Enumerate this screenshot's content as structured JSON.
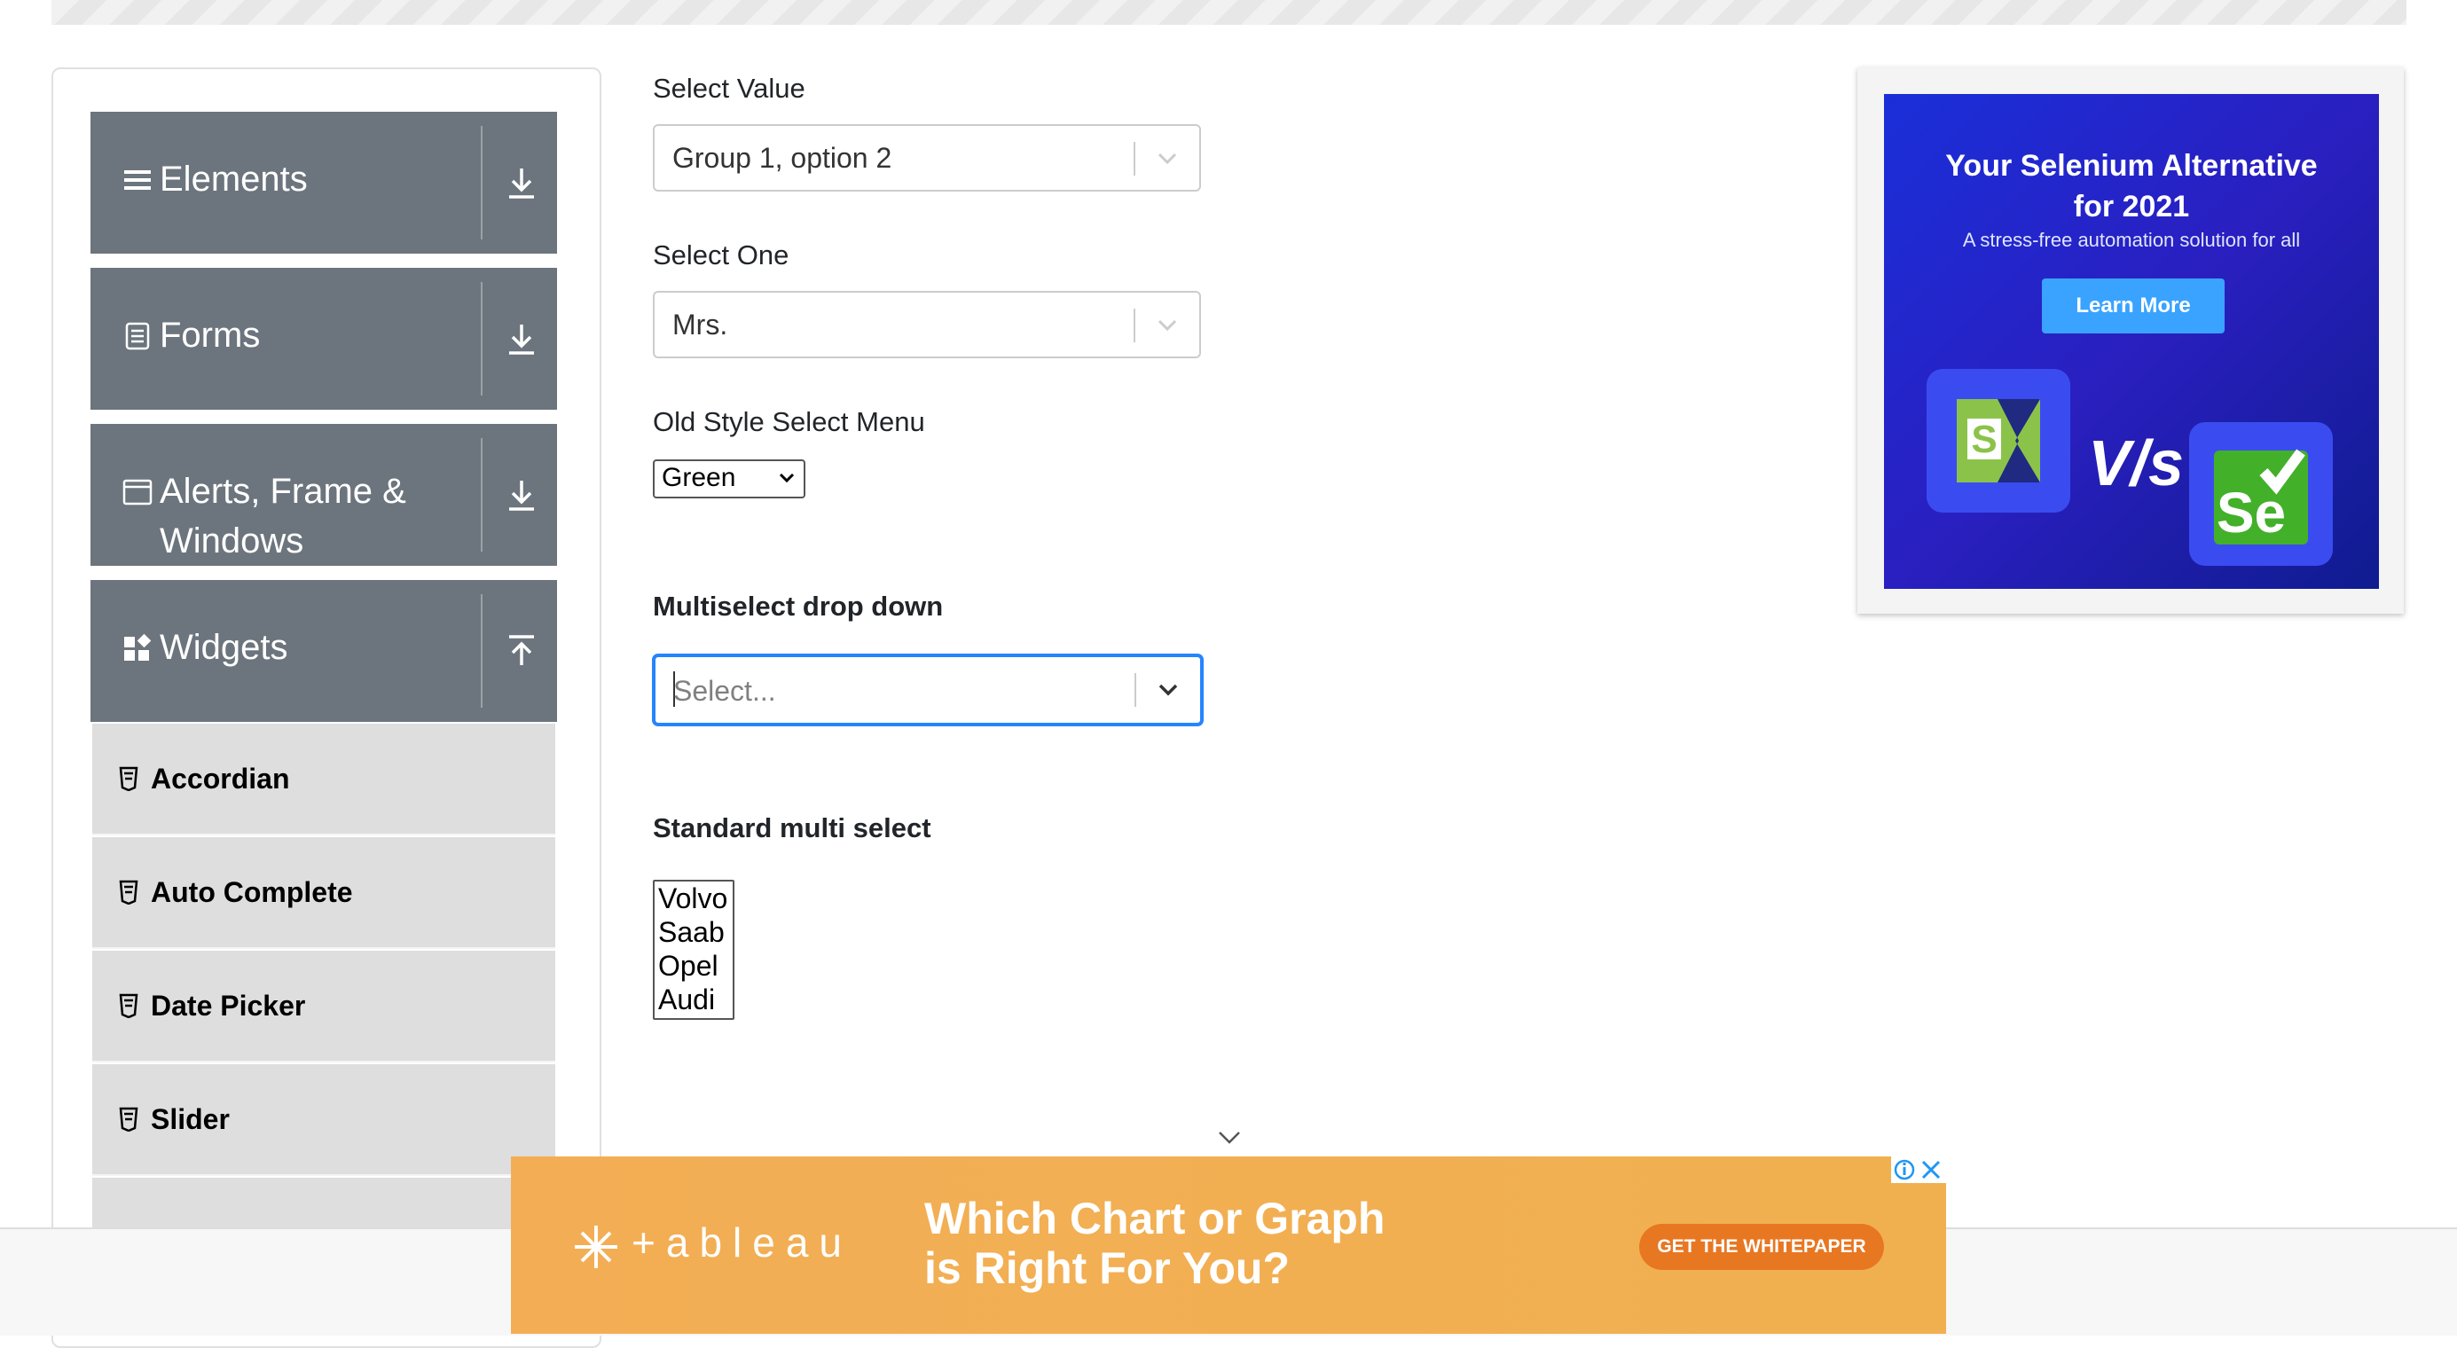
{
  "sidebar": {
    "groups": [
      {
        "label": "Elements",
        "icon": "hamburger-icon",
        "arrow": "download-arrow-icon"
      },
      {
        "label": "Forms",
        "icon": "document-icon",
        "arrow": "download-arrow-icon"
      },
      {
        "label": "Alerts, Frame &",
        "label2": "Windows",
        "icon": "window-icon",
        "arrow": "download-arrow-icon"
      },
      {
        "label": "Widgets",
        "icon": "widgets-icon",
        "arrow": "upload-arrow-icon"
      }
    ],
    "items": [
      {
        "label": "Accordian",
        "icon": "html5-icon"
      },
      {
        "label": "Auto Complete",
        "icon": "html5-icon"
      },
      {
        "label": "Date Picker",
        "icon": "html5-icon"
      },
      {
        "label": "Slider",
        "icon": "html5-icon"
      }
    ]
  },
  "main": {
    "select_value": {
      "label": "Select Value",
      "value": "Group 1, option 2"
    },
    "select_one": {
      "label": "Select One",
      "value": "Mrs."
    },
    "old_select": {
      "label": "Old Style Select Menu",
      "value": "Green"
    },
    "multiselect": {
      "label": "Multiselect drop down",
      "placeholder": "Select..."
    },
    "standard_multi": {
      "label": "Standard multi select",
      "options": [
        "Volvo",
        "Saab",
        "Opel",
        "Audi"
      ]
    }
  },
  "ad_right": {
    "title_line1": "Your Selenium Alternative",
    "title_line2": "for 2021",
    "subtitle": "A stress-free automation solution for all",
    "button": "Learn More",
    "vs": "V/s",
    "logo_left": "S",
    "logo_right": "Se"
  },
  "ad_bottom": {
    "brand": "+ableau",
    "headline_line1": "Which Chart or Graph",
    "headline_line2": "is Right For You?",
    "cta": "GET THE WHITEPAPER"
  },
  "colors": {
    "sidebar_group": "#6c757d",
    "sidebar_item": "#dedede",
    "focus_border": "#2684ff",
    "ad_bottom_bg": "#f0ad4e",
    "ad_right_bg": "#1a2fd9"
  }
}
